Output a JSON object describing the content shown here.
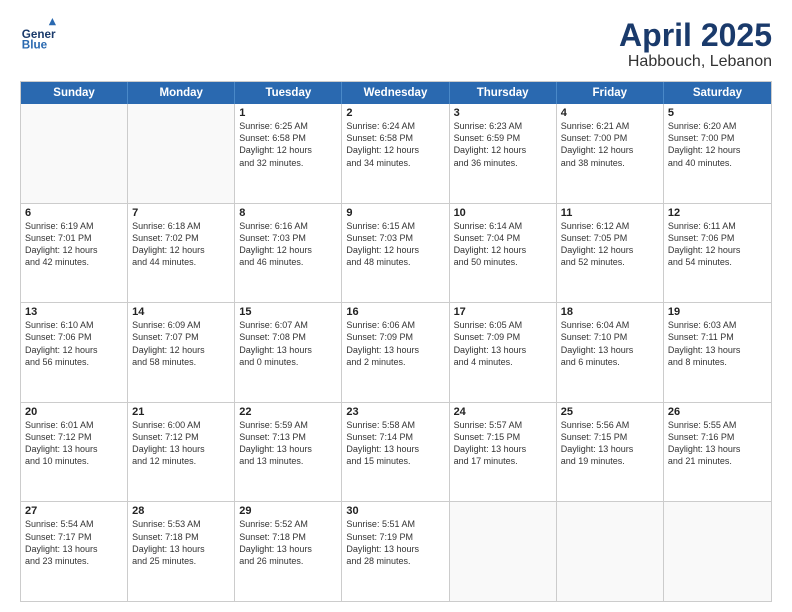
{
  "header": {
    "logo_line1": "General",
    "logo_line2": "Blue",
    "month": "April 2025",
    "location": "Habbouch, Lebanon"
  },
  "weekdays": [
    "Sunday",
    "Monday",
    "Tuesday",
    "Wednesday",
    "Thursday",
    "Friday",
    "Saturday"
  ],
  "rows": [
    [
      {
        "day": "",
        "text": ""
      },
      {
        "day": "",
        "text": ""
      },
      {
        "day": "1",
        "text": "Sunrise: 6:25 AM\nSunset: 6:58 PM\nDaylight: 12 hours\nand 32 minutes."
      },
      {
        "day": "2",
        "text": "Sunrise: 6:24 AM\nSunset: 6:58 PM\nDaylight: 12 hours\nand 34 minutes."
      },
      {
        "day": "3",
        "text": "Sunrise: 6:23 AM\nSunset: 6:59 PM\nDaylight: 12 hours\nand 36 minutes."
      },
      {
        "day": "4",
        "text": "Sunrise: 6:21 AM\nSunset: 7:00 PM\nDaylight: 12 hours\nand 38 minutes."
      },
      {
        "day": "5",
        "text": "Sunrise: 6:20 AM\nSunset: 7:00 PM\nDaylight: 12 hours\nand 40 minutes."
      }
    ],
    [
      {
        "day": "6",
        "text": "Sunrise: 6:19 AM\nSunset: 7:01 PM\nDaylight: 12 hours\nand 42 minutes."
      },
      {
        "day": "7",
        "text": "Sunrise: 6:18 AM\nSunset: 7:02 PM\nDaylight: 12 hours\nand 44 minutes."
      },
      {
        "day": "8",
        "text": "Sunrise: 6:16 AM\nSunset: 7:03 PM\nDaylight: 12 hours\nand 46 minutes."
      },
      {
        "day": "9",
        "text": "Sunrise: 6:15 AM\nSunset: 7:03 PM\nDaylight: 12 hours\nand 48 minutes."
      },
      {
        "day": "10",
        "text": "Sunrise: 6:14 AM\nSunset: 7:04 PM\nDaylight: 12 hours\nand 50 minutes."
      },
      {
        "day": "11",
        "text": "Sunrise: 6:12 AM\nSunset: 7:05 PM\nDaylight: 12 hours\nand 52 minutes."
      },
      {
        "day": "12",
        "text": "Sunrise: 6:11 AM\nSunset: 7:06 PM\nDaylight: 12 hours\nand 54 minutes."
      }
    ],
    [
      {
        "day": "13",
        "text": "Sunrise: 6:10 AM\nSunset: 7:06 PM\nDaylight: 12 hours\nand 56 minutes."
      },
      {
        "day": "14",
        "text": "Sunrise: 6:09 AM\nSunset: 7:07 PM\nDaylight: 12 hours\nand 58 minutes."
      },
      {
        "day": "15",
        "text": "Sunrise: 6:07 AM\nSunset: 7:08 PM\nDaylight: 13 hours\nand 0 minutes."
      },
      {
        "day": "16",
        "text": "Sunrise: 6:06 AM\nSunset: 7:09 PM\nDaylight: 13 hours\nand 2 minutes."
      },
      {
        "day": "17",
        "text": "Sunrise: 6:05 AM\nSunset: 7:09 PM\nDaylight: 13 hours\nand 4 minutes."
      },
      {
        "day": "18",
        "text": "Sunrise: 6:04 AM\nSunset: 7:10 PM\nDaylight: 13 hours\nand 6 minutes."
      },
      {
        "day": "19",
        "text": "Sunrise: 6:03 AM\nSunset: 7:11 PM\nDaylight: 13 hours\nand 8 minutes."
      }
    ],
    [
      {
        "day": "20",
        "text": "Sunrise: 6:01 AM\nSunset: 7:12 PM\nDaylight: 13 hours\nand 10 minutes."
      },
      {
        "day": "21",
        "text": "Sunrise: 6:00 AM\nSunset: 7:12 PM\nDaylight: 13 hours\nand 12 minutes."
      },
      {
        "day": "22",
        "text": "Sunrise: 5:59 AM\nSunset: 7:13 PM\nDaylight: 13 hours\nand 13 minutes."
      },
      {
        "day": "23",
        "text": "Sunrise: 5:58 AM\nSunset: 7:14 PM\nDaylight: 13 hours\nand 15 minutes."
      },
      {
        "day": "24",
        "text": "Sunrise: 5:57 AM\nSunset: 7:15 PM\nDaylight: 13 hours\nand 17 minutes."
      },
      {
        "day": "25",
        "text": "Sunrise: 5:56 AM\nSunset: 7:15 PM\nDaylight: 13 hours\nand 19 minutes."
      },
      {
        "day": "26",
        "text": "Sunrise: 5:55 AM\nSunset: 7:16 PM\nDaylight: 13 hours\nand 21 minutes."
      }
    ],
    [
      {
        "day": "27",
        "text": "Sunrise: 5:54 AM\nSunset: 7:17 PM\nDaylight: 13 hours\nand 23 minutes."
      },
      {
        "day": "28",
        "text": "Sunrise: 5:53 AM\nSunset: 7:18 PM\nDaylight: 13 hours\nand 25 minutes."
      },
      {
        "day": "29",
        "text": "Sunrise: 5:52 AM\nSunset: 7:18 PM\nDaylight: 13 hours\nand 26 minutes."
      },
      {
        "day": "30",
        "text": "Sunrise: 5:51 AM\nSunset: 7:19 PM\nDaylight: 13 hours\nand 28 minutes."
      },
      {
        "day": "",
        "text": ""
      },
      {
        "day": "",
        "text": ""
      },
      {
        "day": "",
        "text": ""
      }
    ]
  ]
}
